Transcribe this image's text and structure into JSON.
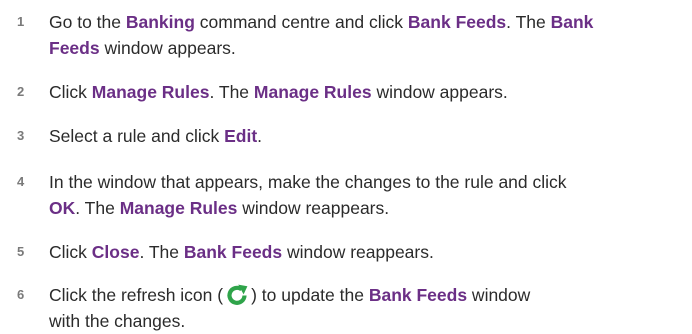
{
  "steps": [
    {
      "number": "1",
      "lines": [
        [
          {
            "text": "Go to the ",
            "bold": false
          },
          {
            "text": "Banking",
            "bold": true
          },
          {
            "text": " command centre and click ",
            "bold": false
          },
          {
            "text": "Bank Feeds",
            "bold": true
          },
          {
            "text": ". The ",
            "bold": false
          },
          {
            "text": "Bank",
            "bold": true
          }
        ],
        [
          {
            "text": "Feeds",
            "bold": true
          },
          {
            "text": " window appears.",
            "bold": false
          }
        ]
      ]
    },
    {
      "number": "2",
      "lines": [
        [
          {
            "text": "Click ",
            "bold": false
          },
          {
            "text": "Manage Rules",
            "bold": true
          },
          {
            "text": ". The ",
            "bold": false
          },
          {
            "text": "Manage Rules",
            "bold": true
          },
          {
            "text": " window appears.",
            "bold": false
          }
        ]
      ]
    },
    {
      "number": "3",
      "lines": [
        [
          {
            "text": "Select a rule and click ",
            "bold": false
          },
          {
            "text": "Edit",
            "bold": true
          },
          {
            "text": ".",
            "bold": false
          }
        ]
      ]
    },
    {
      "number": "4",
      "lines": [
        [
          {
            "text": "In the window that appears, make the changes to the rule and click",
            "bold": false
          }
        ],
        [
          {
            "text": "OK",
            "bold": true
          },
          {
            "text": ". The ",
            "bold": false
          },
          {
            "text": "Manage Rules",
            "bold": true
          },
          {
            "text": " window reappears.",
            "bold": false
          }
        ]
      ]
    },
    {
      "number": "5",
      "lines": [
        [
          {
            "text": "Click ",
            "bold": false
          },
          {
            "text": "Close",
            "bold": true
          },
          {
            "text": ". The ",
            "bold": false
          },
          {
            "text": "Bank Feeds",
            "bold": true
          },
          {
            "text": " window reappears.",
            "bold": false
          }
        ]
      ]
    },
    {
      "number": "6",
      "lines": [
        [
          {
            "text": "Click the refresh icon (",
            "bold": false
          },
          {
            "icon": "refresh-icon"
          },
          {
            "text": ") to update the ",
            "bold": false
          },
          {
            "text": "Bank Feeds",
            "bold": true
          },
          {
            "text": " window",
            "bold": false
          }
        ],
        [
          {
            "text": "with the changes.",
            "bold": false
          }
        ]
      ]
    }
  ],
  "colors": {
    "highlight": "#6b2f86",
    "body_text": "#2b2b2b",
    "step_number": "#7a7a7a",
    "refresh_icon": "#2fa44a"
  }
}
